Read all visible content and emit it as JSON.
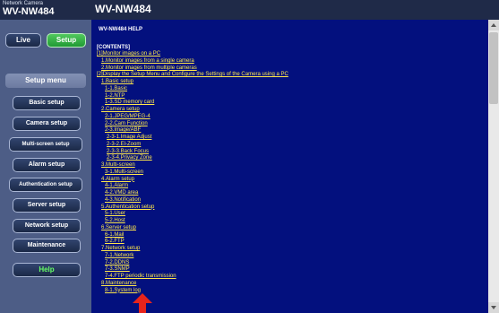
{
  "header": {
    "caption": "Network Camera",
    "model": "WV-NW484",
    "page_title": "WV-NW484"
  },
  "nav": {
    "live": "Live",
    "setup": "Setup"
  },
  "sidebar": {
    "menu_label": "Setup menu",
    "items": [
      "Basic setup",
      "Camera setup",
      "Multi-screen setup",
      "Alarm setup",
      "Authentication setup",
      "Server setup",
      "Network setup",
      "Maintenance"
    ],
    "help": "Help"
  },
  "help": {
    "title": "WV-NW484 HELP",
    "contents_heading": "[CONTENTS]",
    "toc": [
      {
        "text": "[1]Monitor images on a PC",
        "level": 0
      },
      {
        "text": "1.Monitor images from a single camera",
        "level": 1
      },
      {
        "text": "2.Monitor images from multiple cameras",
        "level": 1
      },
      {
        "text": "[2]Display the Setup Menu and Configure the Settings of the Camera using a PC",
        "level": 0
      },
      {
        "text": "1.Basic setup",
        "level": 1
      },
      {
        "text": "1-1.Basic",
        "level": 2
      },
      {
        "text": "1-2.NTP",
        "level": 2
      },
      {
        "text": "1-3.SD memory card",
        "level": 2
      },
      {
        "text": "2.Camera setup",
        "level": 1
      },
      {
        "text": "2-1.JPEG/MPEG-4",
        "level": 2
      },
      {
        "text": "2-2.Cam Function",
        "level": 2
      },
      {
        "text": "2-3.Image/ABF",
        "level": 2
      },
      {
        "text": "2-3-1.Image Adjust",
        "level": 3
      },
      {
        "text": "2-3-2.El-Zoom",
        "level": 3
      },
      {
        "text": "2-3-3.Back Focus",
        "level": 3
      },
      {
        "text": "2-3-4.Privacy Zone",
        "level": 3
      },
      {
        "text": "3.Multi-screen",
        "level": 1
      },
      {
        "text": "3-1.Multi-screen",
        "level": 2
      },
      {
        "text": "4.Alarm setup",
        "level": 1
      },
      {
        "text": "4-1.Alarm",
        "level": 2
      },
      {
        "text": "4-2.VMD area",
        "level": 2
      },
      {
        "text": "4-3.Notification",
        "level": 2
      },
      {
        "text": "5.Authentication setup",
        "level": 1
      },
      {
        "text": "5-1.User",
        "level": 2
      },
      {
        "text": "5-2.Host",
        "level": 2
      },
      {
        "text": "6.Server setup",
        "level": 1
      },
      {
        "text": "6-1.Mail",
        "level": 2
      },
      {
        "text": "6-2.FTP",
        "level": 2
      },
      {
        "text": "7.Network setup",
        "level": 1
      },
      {
        "text": "7-1.Network",
        "level": 2
      },
      {
        "text": "7-2.DDNS",
        "level": 2
      },
      {
        "text": "7-3.SNMP",
        "level": 2
      },
      {
        "text": "7-4.FTP periodic transmission",
        "level": 2
      },
      {
        "text": "8.Maintenance",
        "level": 1
      },
      {
        "text": "8-1.System log",
        "level": 2
      }
    ]
  },
  "colors": {
    "cursor": "#e8241c"
  },
  "icons": {
    "cursor": "red-arrow-cursor-icon"
  }
}
